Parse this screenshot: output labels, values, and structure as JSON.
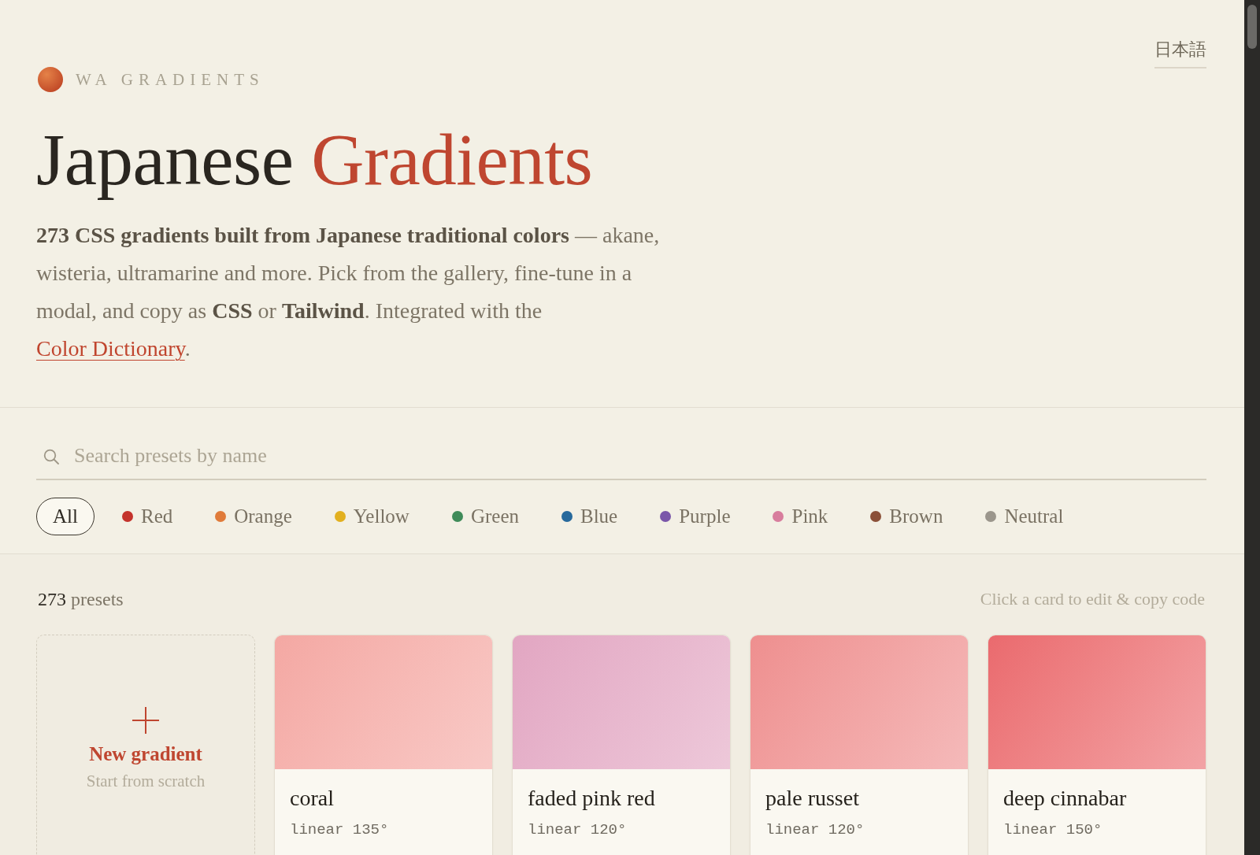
{
  "language_link": "日本語",
  "brand": "WA GRADIENTS",
  "title": {
    "main": "Japanese",
    "accent": "Gradients"
  },
  "intro": {
    "text": "**273 CSS gradients built from Japanese traditional colors** — akane, wisteria, ultramarine and more. Pick from the gallery, fine-tune in a modal, and copy as **CSS** or **Tailwind**. Integrated with the ",
    "link": "Color Dictionary",
    "end": "."
  },
  "search": {
    "placeholder": "Search presets by name"
  },
  "filters": [
    {
      "kind": "all",
      "label": "All",
      "selected": true
    },
    {
      "kind": "color",
      "label": "Red",
      "selected": false,
      "color": "#c4332c"
    },
    {
      "kind": "color",
      "label": "Orange",
      "selected": false,
      "color": "#e07b3a"
    },
    {
      "kind": "color",
      "label": "Yellow",
      "selected": false,
      "color": "#e2b01f"
    },
    {
      "kind": "color",
      "label": "Green",
      "selected": false,
      "color": "#3f8b59"
    },
    {
      "kind": "color",
      "label": "Blue",
      "selected": false,
      "color": "#27699c"
    },
    {
      "kind": "color",
      "label": "Purple",
      "selected": false,
      "color": "#7a56a9"
    },
    {
      "kind": "color",
      "label": "Pink",
      "selected": false,
      "color": "#d87d9d"
    },
    {
      "kind": "color",
      "label": "Brown",
      "selected": false,
      "color": "#8b5038"
    },
    {
      "kind": "color",
      "label": "Neutral",
      "selected": false,
      "color": "#9b968c"
    }
  ],
  "gallery": {
    "count": "273",
    "count_label": "presets",
    "hint": "Click a card to edit & copy code"
  },
  "new_card": {
    "label": "New gradient",
    "sublabel": "Start from scratch"
  },
  "presets": [
    {
      "name": "coral",
      "meta": "linear 135°",
      "color": "#f4a8a3"
    },
    {
      "name": "faded pink red",
      "meta": "linear 120°",
      "color": "#e2a6c2"
    },
    {
      "name": "pale russet",
      "meta": "linear 120°",
      "color": "#ee8f8f"
    },
    {
      "name": "deep cinnabar",
      "meta": "linear 150°",
      "color": "#ea6a6e"
    }
  ]
}
